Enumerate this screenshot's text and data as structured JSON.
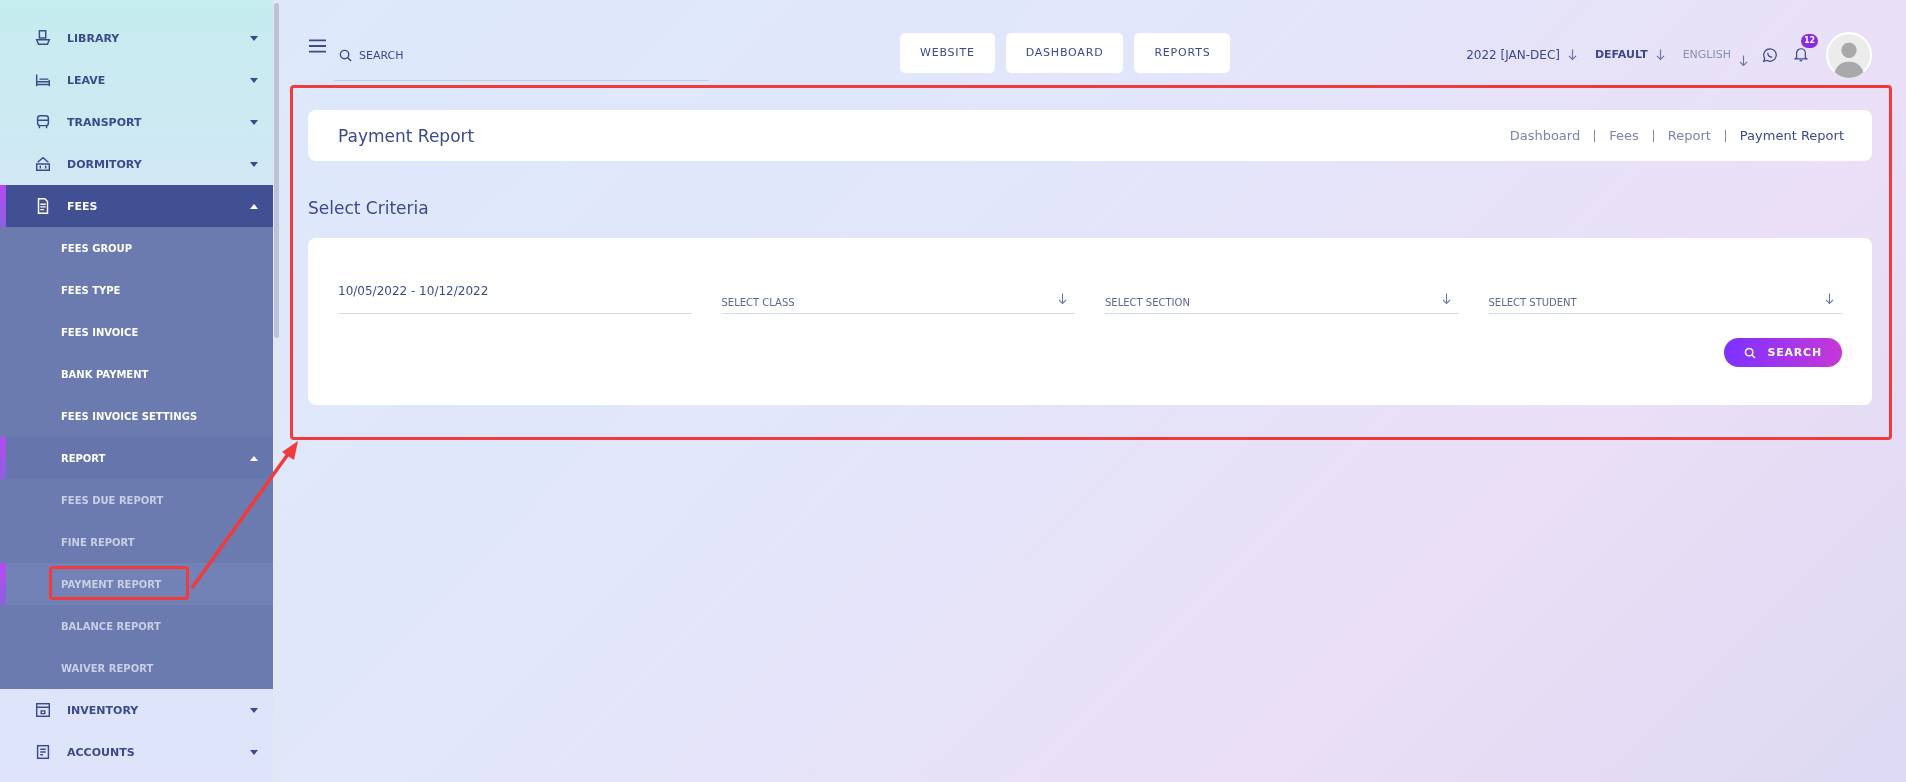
{
  "sidebar": {
    "items": [
      {
        "label": "LIBRARY",
        "expanded": false,
        "selected": false
      },
      {
        "label": "LEAVE",
        "expanded": false,
        "selected": false
      },
      {
        "label": "TRANSPORT",
        "expanded": false,
        "selected": false
      },
      {
        "label": "DORMITORY",
        "expanded": false,
        "selected": false
      },
      {
        "label": "FEES",
        "expanded": true,
        "selected": true,
        "children": [
          {
            "label": "FEES GROUP",
            "selected": false
          },
          {
            "label": "FEES TYPE",
            "selected": false
          },
          {
            "label": "FEES INVOICE",
            "selected": false
          },
          {
            "label": "BANK PAYMENT",
            "selected": false
          },
          {
            "label": "FEES INVOICE SETTINGS",
            "selected": false
          },
          {
            "label": "REPORT",
            "expanded": true,
            "selected": true,
            "children": [
              {
                "label": "FEES DUE REPORT",
                "selected": false
              },
              {
                "label": "FINE REPORT",
                "selected": false
              },
              {
                "label": "PAYMENT REPORT",
                "selected": true
              },
              {
                "label": "BALANCE REPORT",
                "selected": false
              },
              {
                "label": "WAIVER REPORT",
                "selected": false
              }
            ]
          }
        ]
      },
      {
        "label": "INVENTORY",
        "expanded": false,
        "selected": false
      },
      {
        "label": "ACCOUNTS",
        "expanded": false,
        "selected": false
      }
    ]
  },
  "header": {
    "search": {
      "placeholder": "SEARCH"
    },
    "nav_buttons": [
      "WEBSITE",
      "DASHBOARD",
      "REPORTS"
    ],
    "session": "2022 [JAN-DEC]",
    "style": "DEFAULT",
    "language": "ENGLISH",
    "notifications": "12"
  },
  "page": {
    "title": "Payment Report",
    "breadcrumb": [
      {
        "label": "Dashboard",
        "selected": false
      },
      {
        "label": "Fees",
        "selected": false
      },
      {
        "label": "Report",
        "selected": false
      },
      {
        "label": "Payment Report",
        "selected": true
      }
    ],
    "section_title": "Select Criteria",
    "filters": [
      {
        "kind": "input",
        "value": "10/05/2022 - 10/12/2022"
      },
      {
        "kind": "select",
        "placeholder": "SELECT CLASS"
      },
      {
        "kind": "select",
        "placeholder": "SELECT SECTION"
      },
      {
        "kind": "select",
        "placeholder": "SELECT STUDENT"
      }
    ],
    "search_button": "SEARCH"
  }
}
